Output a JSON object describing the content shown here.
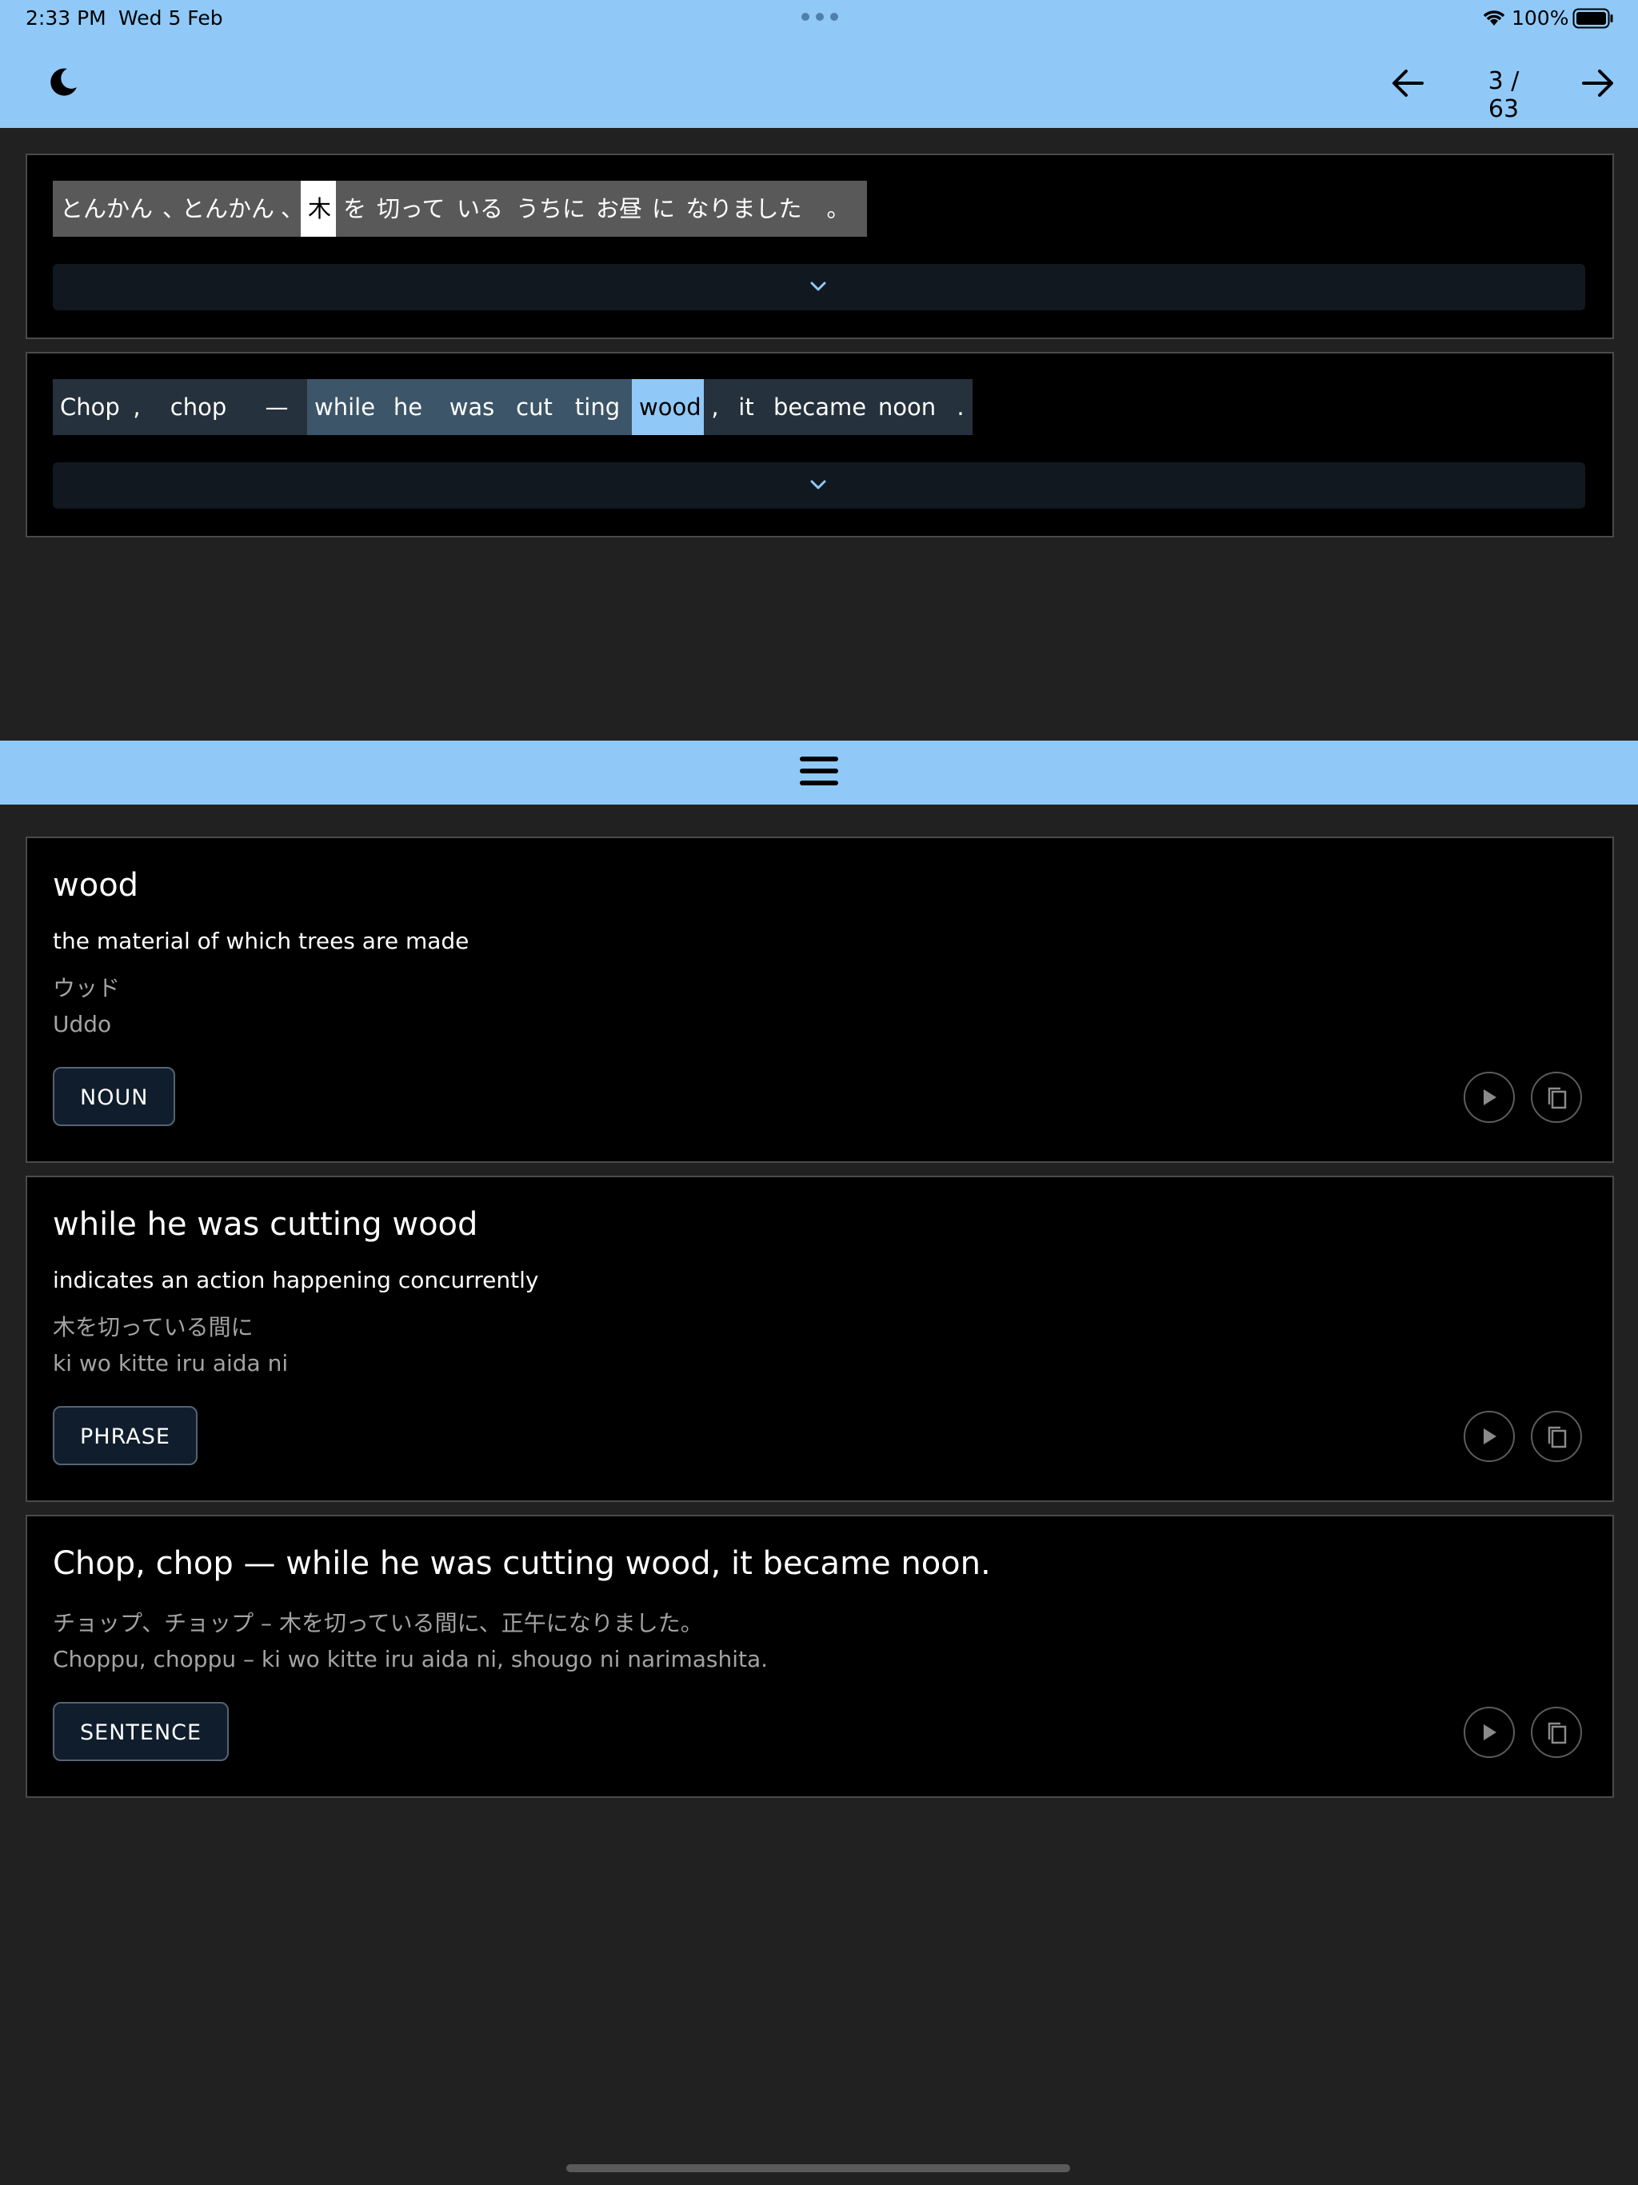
{
  "status_bar": {
    "time": "2:33 PM",
    "date": "Wed 5 Feb",
    "battery": "100%"
  },
  "header": {
    "page_current": "3",
    "page_total": "63",
    "page_display": "3 / 63"
  },
  "japanese_sentence": {
    "tokens": [
      "とんかん",
      "、",
      "とんかん",
      "、",
      "木",
      "を",
      "切って",
      "いる",
      "うちに",
      "お昼",
      "に",
      "なりました",
      "。"
    ],
    "selected_index": 4
  },
  "english_sentence": {
    "tokens": [
      "Chop",
      ",",
      "chop",
      "—",
      "while",
      "he",
      "was",
      "cut",
      "ting",
      "wood",
      ",",
      "it",
      "became",
      "noon",
      "."
    ],
    "highlight_index": 9
  },
  "cards": [
    {
      "title": "wood",
      "definition": "the material of which trees are made",
      "kana": "ウッド",
      "romaji": "Uddo",
      "badge": "NOUN"
    },
    {
      "title": "while he was cutting wood",
      "definition": "indicates an action happening concurrently",
      "kana": "木を切っている間に",
      "romaji": "ki wo kitte iru aida ni",
      "badge": "PHRASE"
    },
    {
      "title": "Chop, chop — while he was cutting wood, it became noon.",
      "kana": "チョップ、チョップ – 木を切っている間に、正午になりました。",
      "romaji": "Choppu, choppu – ki wo kitte iru aida ni, shougo ni narimashita.",
      "badge": "SENTENCE"
    }
  ],
  "icons": {
    "theme": "moon-icon",
    "prev": "arrow-left-icon",
    "next": "arrow-right-icon",
    "expand": "chevron-down-icon",
    "menu": "hamburger-icon",
    "play": "play-icon",
    "copy": "copy-icon"
  },
  "colors": {
    "accent": "#90C9F7",
    "panel": "#000000",
    "background": "#212121"
  }
}
